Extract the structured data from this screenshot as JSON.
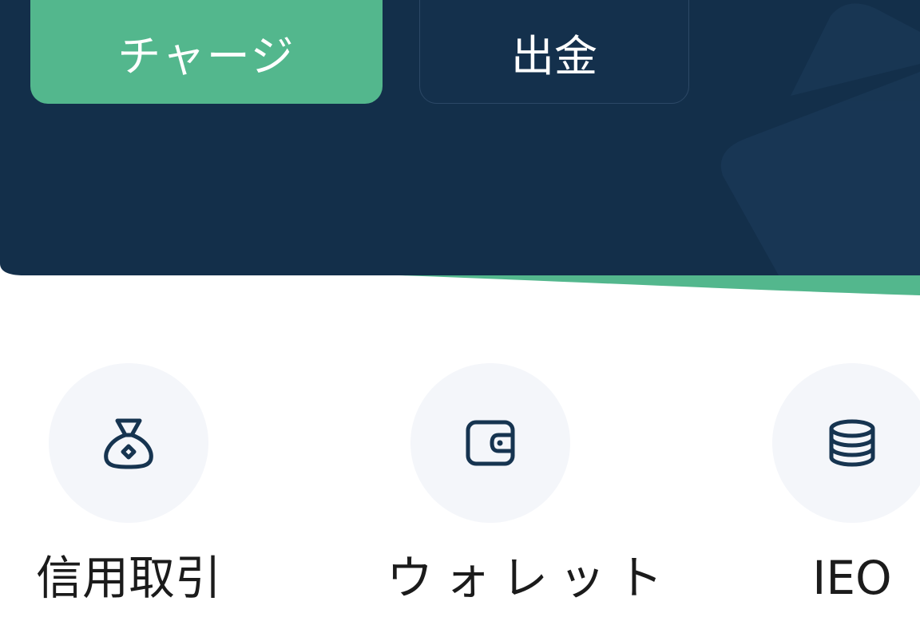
{
  "header": {
    "charge_label": "チャージ",
    "withdraw_label": "出金"
  },
  "quick_actions": [
    {
      "label": "信用取引",
      "icon": "money-bag-icon"
    },
    {
      "label": "ウォレット",
      "icon": "wallet-icon"
    },
    {
      "label": "IEO",
      "icon": "database-icon"
    }
  ],
  "colors": {
    "header_bg": "#132f4a",
    "accent_green": "#53b78d",
    "icon_stroke": "#163450",
    "circle_bg": "#f4f6fa"
  }
}
